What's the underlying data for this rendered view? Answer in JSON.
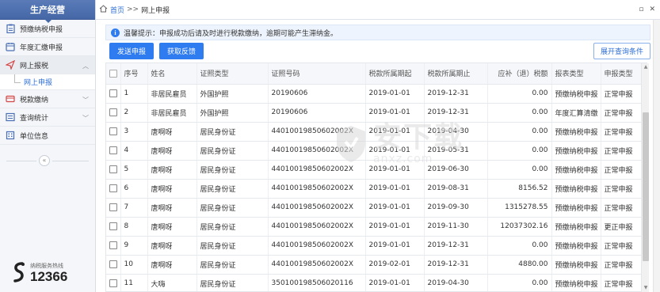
{
  "sidebar": {
    "title": "生产经营",
    "items": [
      {
        "label": "预缴纳税申报",
        "icon": "clipboard-icon"
      },
      {
        "label": "年度汇缴申报",
        "icon": "calendar-icon"
      },
      {
        "label": "网上报税",
        "icon": "send-icon"
      },
      {
        "label": "网上申报",
        "icon": ""
      },
      {
        "label": "税款缴纳",
        "icon": "payment-icon"
      },
      {
        "label": "查询统计",
        "icon": "query-icon"
      },
      {
        "label": "单位信息",
        "icon": "building-icon"
      }
    ],
    "hotline": {
      "label": "纳税服务热线",
      "number": "12366"
    }
  },
  "topbar": {
    "home": "首页",
    "sep": ">>",
    "current": "网上申报"
  },
  "notice": {
    "text": "温馨提示：申报成功后请及时进行税款缴纳，逾期可能产生滞纳金。"
  },
  "buttons": {
    "send": "发送申报",
    "fetch": "获取反馈",
    "expand": "展开查询条件"
  },
  "table": {
    "headers": [
      "序号",
      "姓名",
      "证照类型",
      "证照号码",
      "税款所属期起",
      "税款所属期止",
      "应补（退）税额",
      "报表类型",
      "申报类型"
    ],
    "rows": [
      [
        "1",
        "非居民雇员",
        "外国护照",
        "20190606",
        "2019-01-01",
        "2019-12-31",
        "0.00",
        "预缴纳税申报",
        "正常申报"
      ],
      [
        "2",
        "非居民雇员",
        "外国护照",
        "20190606",
        "2019-01-01",
        "2019-12-31",
        "0.00",
        "年度汇算清缴",
        "正常申报"
      ],
      [
        "3",
        "唐啊呀",
        "居民身份证",
        "44010019850602002X",
        "2019-01-01",
        "2019-04-30",
        "0.00",
        "预缴纳税申报",
        "正常申报"
      ],
      [
        "4",
        "唐啊呀",
        "居民身份证",
        "44010019850602002X",
        "2019-01-01",
        "2019-05-31",
        "0.00",
        "预缴纳税申报",
        "正常申报"
      ],
      [
        "5",
        "唐啊呀",
        "居民身份证",
        "44010019850602002X",
        "2019-01-01",
        "2019-06-30",
        "0.00",
        "预缴纳税申报",
        "正常申报"
      ],
      [
        "6",
        "唐啊呀",
        "居民身份证",
        "44010019850602002X",
        "2019-01-01",
        "2019-08-31",
        "8156.52",
        "预缴纳税申报",
        "正常申报"
      ],
      [
        "7",
        "唐啊呀",
        "居民身份证",
        "44010019850602002X",
        "2019-01-01",
        "2019-09-30",
        "1315278.55",
        "预缴纳税申报",
        "正常申报"
      ],
      [
        "8",
        "唐啊呀",
        "居民身份证",
        "44010019850602002X",
        "2019-01-01",
        "2019-11-30",
        "12037302.16",
        "预缴纳税申报",
        "更正申报"
      ],
      [
        "9",
        "唐啊呀",
        "居民身份证",
        "44010019850602002X",
        "2019-01-01",
        "2019-12-31",
        "0.00",
        "预缴纳税申报",
        "正常申报"
      ],
      [
        "10",
        "唐啊呀",
        "居民身份证",
        "44010019850602002X",
        "2019-02-01",
        "2019-12-31",
        "4880.00",
        "预缴纳税申报",
        "正常申报"
      ],
      [
        "11",
        "大嗨",
        "居民身份证",
        "350100198506020116",
        "2019-01-01",
        "2019-04-30",
        "0.00",
        "预缴纳税申报",
        "正常申报"
      ]
    ]
  },
  "watermark": {
    "cn": "安下载",
    "en": "anxz.com"
  },
  "colors": {
    "accent": "#2f7cf0",
    "sidebar_head": "#4567a6"
  }
}
